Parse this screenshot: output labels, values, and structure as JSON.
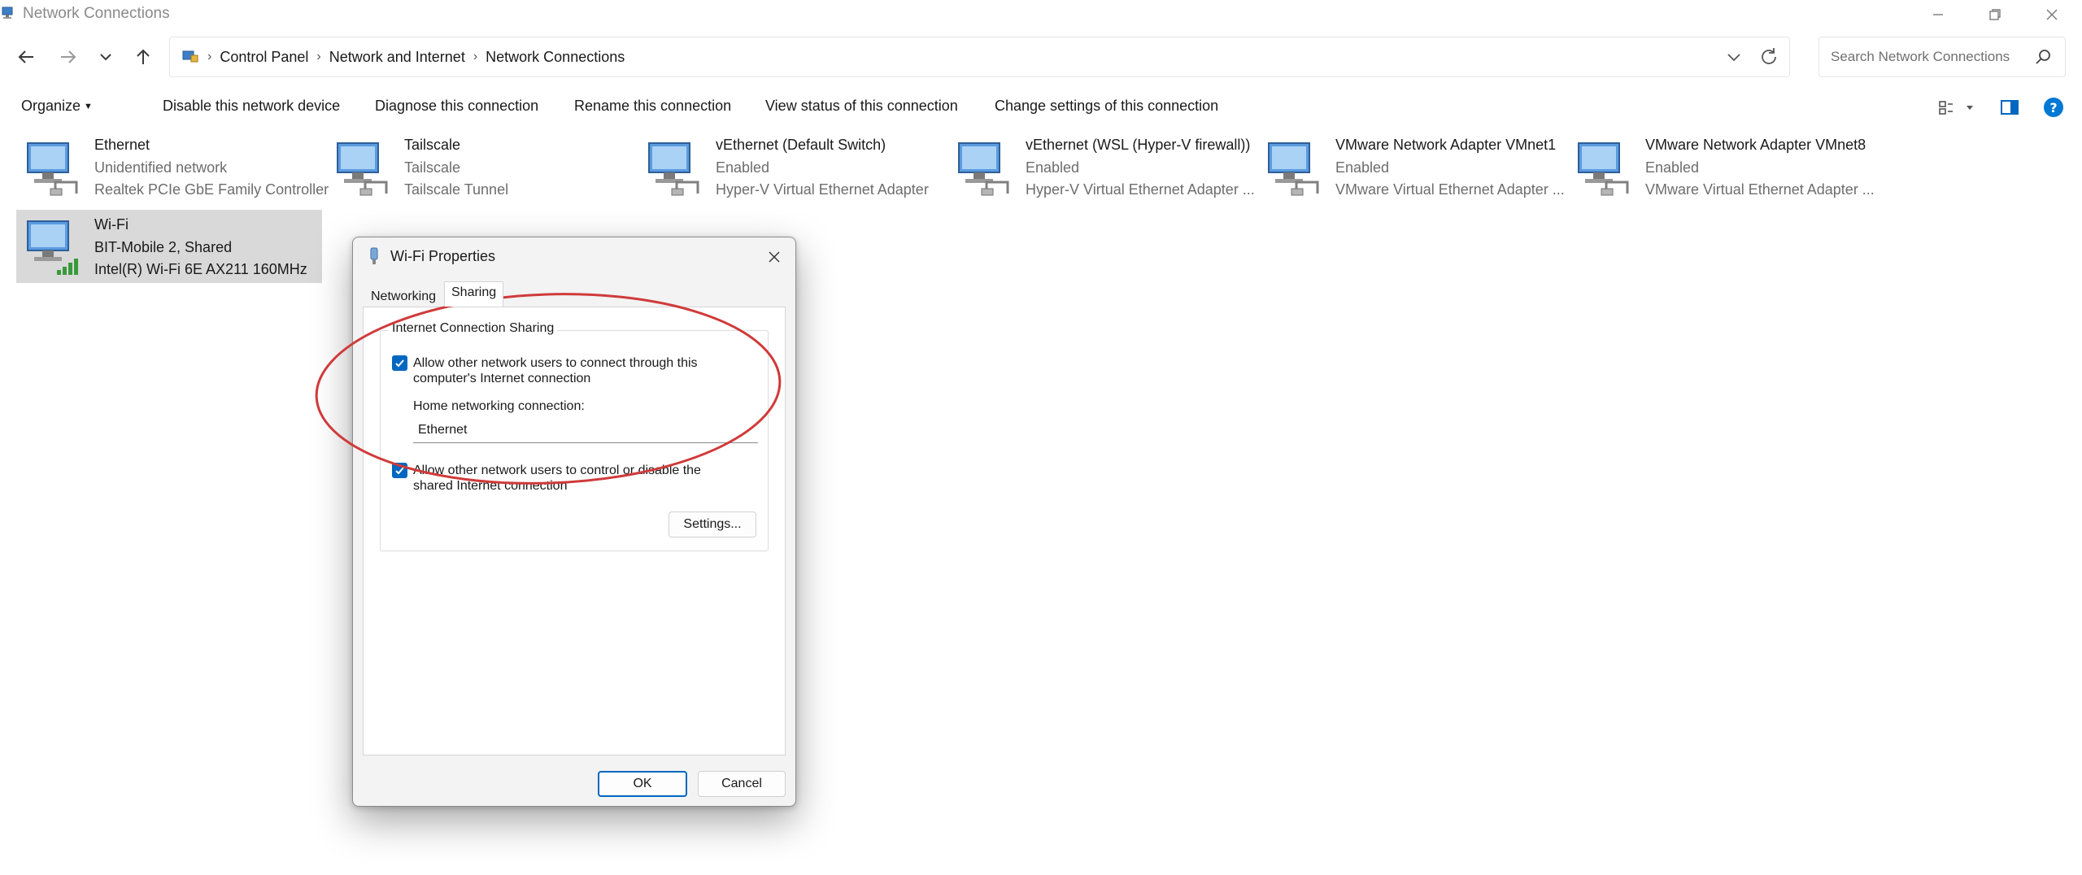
{
  "window": {
    "title": "Network Connections",
    "minimize_icon": "minimize-icon",
    "restore_icon": "restore-icon",
    "close_icon": "close-icon"
  },
  "nav": {
    "breadcrumbs": [
      "Control Panel",
      "Network and Internet",
      "Network Connections"
    ],
    "search_placeholder": "Search Network Connections"
  },
  "commands": {
    "organize": "Organize",
    "disable": "Disable this network device",
    "diagnose": "Diagnose this connection",
    "rename": "Rename this connection",
    "view_status": "View status of this connection",
    "change_settings": "Change settings of this connection"
  },
  "connections": [
    {
      "name": "Ethernet",
      "status": "Unidentified network",
      "device": "Realtek PCIe GbE Family Controller"
    },
    {
      "name": "Tailscale",
      "status": "Tailscale",
      "device": "Tailscale Tunnel"
    },
    {
      "name": "vEthernet (Default Switch)",
      "status": "Enabled",
      "device": "Hyper-V Virtual Ethernet Adapter"
    },
    {
      "name": "vEthernet (WSL (Hyper-V firewall))",
      "status": "Enabled",
      "device": "Hyper-V Virtual Ethernet Adapter ..."
    },
    {
      "name": "VMware Network Adapter VMnet1",
      "status": "Enabled",
      "device": "VMware Virtual Ethernet Adapter ..."
    },
    {
      "name": "VMware Network Adapter VMnet8",
      "status": "Enabled",
      "device": "VMware Virtual Ethernet Adapter ..."
    },
    {
      "name": "Wi-Fi",
      "status": "BIT-Mobile 2, Shared",
      "device": "Intel(R) Wi-Fi 6E AX211 160MHz",
      "selected": true
    }
  ],
  "dialog": {
    "title": "Wi-Fi Properties",
    "tabs": [
      "Networking",
      "Sharing"
    ],
    "active_tab": "Sharing",
    "group_label": "Internet Connection Sharing",
    "allow_connect": {
      "checked": true,
      "line1": "Allow other network users to connect through this",
      "line2": "computer's Internet connection"
    },
    "home_label": "Home networking connection:",
    "home_value": "Ethernet",
    "allow_control": {
      "checked": true,
      "line1": "Allow other network users to control or disable the",
      "line2": "shared Internet connection"
    },
    "settings_button": "Settings...",
    "ok_button": "OK",
    "cancel_button": "Cancel"
  },
  "colors": {
    "accent": "#0067c0",
    "annotation": "#d03a3a",
    "selection": "#d9d9d9"
  }
}
